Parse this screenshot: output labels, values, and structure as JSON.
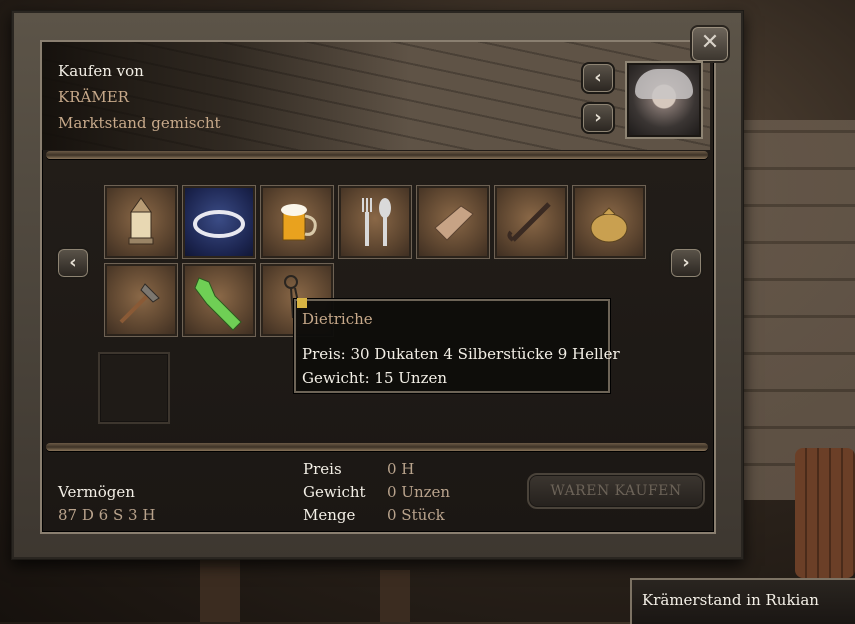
{
  "window": {
    "close_icon": "close-x-icon"
  },
  "header": {
    "title": "Kaufen von",
    "merchant": "KRÄMER",
    "stand": "Marktstand gemischt",
    "prev_icon": "chevron-left-icon",
    "next_icon": "chevron-right-icon"
  },
  "items": [
    {
      "name": "lantern-icon"
    },
    {
      "name": "necklace-icon"
    },
    {
      "name": "beer-mug-icon"
    },
    {
      "name": "fork-spoon-icon"
    },
    {
      "name": "whetstone-icon"
    },
    {
      "name": "crowbar-icon"
    },
    {
      "name": "pouch-icon"
    },
    {
      "name": "hatchet-icon"
    },
    {
      "name": "bottle-icon"
    },
    {
      "name": "lockpicks-icon"
    }
  ],
  "tooltip": {
    "title": "Dietriche",
    "price": "Preis: 30 Dukaten 4 Silberstücke 9 Heller",
    "weight": "Gewicht: 15 Unzen"
  },
  "footer": {
    "wealth_label": "Vermögen",
    "wealth_value": "87 D 6 S 3 H",
    "price_label": "Preis",
    "price_value": "0 H",
    "weight_label": "Gewicht",
    "weight_value": "0 Unzen",
    "amount_label": "Menge",
    "amount_value": "0 Stück",
    "buy_button": "WAREN KAUFEN"
  },
  "location": {
    "name": "Krämerstand in Rukian"
  },
  "colors": {
    "accent_text": "#c7a98a",
    "text": "#f3efe6",
    "disabled": "#6c6358"
  }
}
